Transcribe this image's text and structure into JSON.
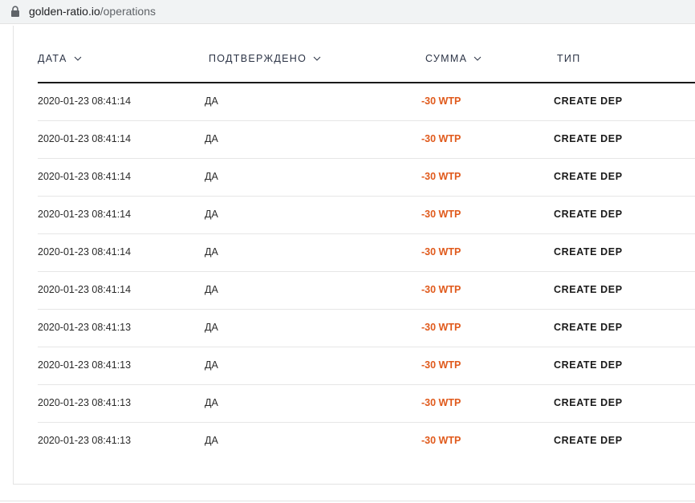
{
  "browser": {
    "url_domain": "golden-ratio.io",
    "url_path": "/operations",
    "lock_icon": "lock-icon"
  },
  "table": {
    "headers": [
      {
        "label": "ДАТА",
        "sortable": true
      },
      {
        "label": "ПОДТВЕРЖДЕНО",
        "sortable": true
      },
      {
        "label": "СУММА",
        "sortable": true
      },
      {
        "label": "ТИП",
        "sortable": false
      }
    ],
    "rows": [
      {
        "date": "2020-01-23 08:41:14",
        "confirmed": "ДА",
        "amount": "-30 WTP",
        "type": "CREATE DEP"
      },
      {
        "date": "2020-01-23 08:41:14",
        "confirmed": "ДА",
        "amount": "-30 WTP",
        "type": "CREATE DEP"
      },
      {
        "date": "2020-01-23 08:41:14",
        "confirmed": "ДА",
        "amount": "-30 WTP",
        "type": "CREATE DEP"
      },
      {
        "date": "2020-01-23 08:41:14",
        "confirmed": "ДА",
        "amount": "-30 WTP",
        "type": "CREATE DEP"
      },
      {
        "date": "2020-01-23 08:41:14",
        "confirmed": "ДА",
        "amount": "-30 WTP",
        "type": "CREATE DEP"
      },
      {
        "date": "2020-01-23 08:41:14",
        "confirmed": "ДА",
        "amount": "-30 WTP",
        "type": "CREATE DEP"
      },
      {
        "date": "2020-01-23 08:41:13",
        "confirmed": "ДА",
        "amount": "-30 WTP",
        "type": "CREATE DEP"
      },
      {
        "date": "2020-01-23 08:41:13",
        "confirmed": "ДА",
        "amount": "-30 WTP",
        "type": "CREATE DEP"
      },
      {
        "date": "2020-01-23 08:41:13",
        "confirmed": "ДА",
        "amount": "-30 WTP",
        "type": "CREATE DEP"
      },
      {
        "date": "2020-01-23 08:41:13",
        "confirmed": "ДА",
        "amount": "-30 WTP",
        "type": "CREATE DEP"
      }
    ]
  },
  "colors": {
    "negative_amount": "#e05a1c",
    "header_text": "#2c3446"
  }
}
